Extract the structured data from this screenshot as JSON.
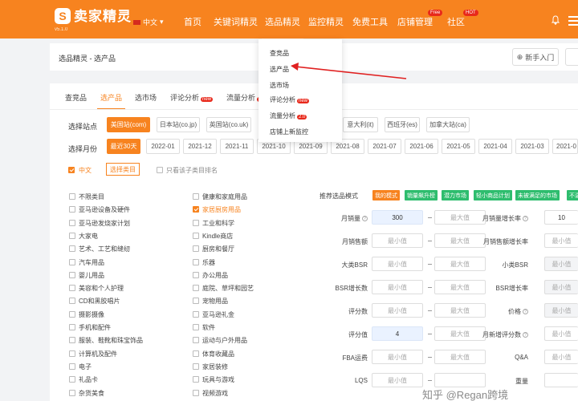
{
  "brand": {
    "logo_glyph": "S",
    "name": "卖家精灵",
    "version": "v5.1.0",
    "accent": "#f7831f"
  },
  "nav": {
    "language": "中文",
    "items": [
      {
        "label": "首页"
      },
      {
        "label": "关键词精灵"
      },
      {
        "label": "选品精灵"
      },
      {
        "label": "监控精灵"
      },
      {
        "label": "免费工具"
      },
      {
        "label": "店铺管理",
        "badge": "Free"
      },
      {
        "label": "社区",
        "badge": "HOT"
      }
    ]
  },
  "breadcrumb": "选品精灵 - 选产品",
  "help": {
    "novice": "新手入门"
  },
  "tabs": [
    {
      "label": "查竞品"
    },
    {
      "label": "选产品"
    },
    {
      "label": "选市场"
    },
    {
      "label": "评论分析",
      "tag": "new"
    },
    {
      "label": "流量分析",
      "tag": "2"
    }
  ],
  "stations": {
    "label": "选择站点",
    "options": [
      "美国站(com)",
      "日本站(co.jp)",
      "英国站(co.uk)",
      "意大利(it)",
      "西班牙(es)",
      "加拿大站(ca)"
    ]
  },
  "months": {
    "label": "选择月份",
    "options": [
      "最近30天",
      "2022-01",
      "2021-12",
      "2021-11",
      "2021-10",
      "2021-09",
      "2021-08",
      "2021-07",
      "2021-06",
      "2021-05",
      "2021-04",
      "2021-03",
      "2021-0"
    ]
  },
  "category_bar": {
    "lang": "中文",
    "select_button": "选择类目",
    "only_label": "只看该子类目排名"
  },
  "categories_left": [
    "不限类目",
    "亚马逊设备及硬件",
    "亚马逊发烧家计划",
    "大家电",
    "艺术、工艺和缝纫",
    "汽车用品",
    "婴儿用品",
    "美容和个人护理",
    "CD和黑胶唱片",
    "摄影摄像",
    "手机和配件",
    "服装、鞋靴和珠宝饰品",
    "计算机及配件",
    "电子",
    "礼品卡",
    "杂货美食"
  ],
  "categories_right": [
    "健康和家庭用品",
    "家居厨房用品",
    "工业和科学",
    "Kindle商店",
    "厨房和餐厅",
    "乐器",
    "办公用品",
    "庭院、草坪和园艺",
    "宠物用品",
    "亚马逊礼金",
    "软件",
    "运动与户外用品",
    "体育收藏品",
    "家居装修",
    "玩具与游戏",
    "视频游戏"
  ],
  "recommend": {
    "label": "推荐选品模式",
    "modes": [
      {
        "label": "我的模式",
        "color": "#f7831f"
      },
      {
        "label": "销量飙升榜",
        "color": "#2ebd6e"
      },
      {
        "label": "潜力市场",
        "color": "#2ebd6e"
      },
      {
        "label": "轻小商品计划",
        "color": "#2ebd6e"
      },
      {
        "label": "未被满足的市场",
        "color": "#2ebd6e"
      },
      {
        "label": "不温",
        "color": "#2ebd6e"
      }
    ]
  },
  "filters_left": [
    {
      "label": "月销量",
      "help": true,
      "min": "300",
      "max": "最大值"
    },
    {
      "label": "月销售额",
      "help": false,
      "min": "最小值",
      "max": "最大值"
    },
    {
      "label": "大类BSR",
      "help": false,
      "min": "最小值",
      "max": "最大值"
    },
    {
      "label": "BSR增长数",
      "help": false,
      "min": "最小值",
      "max": "最大值"
    },
    {
      "label": "评分数",
      "help": false,
      "min": "最小值",
      "max": "最大值"
    },
    {
      "label": "评分值",
      "help": false,
      "min": "4",
      "max": "最大值"
    },
    {
      "label": "FBA运费",
      "help": false,
      "min": "最小值",
      "max": "最大值"
    },
    {
      "label": "LQS",
      "help": false,
      "min": "最小值",
      "max": ""
    }
  ],
  "filters_right": [
    {
      "label": "月销量增长率",
      "help": true,
      "min": "10"
    },
    {
      "label": "月销售额增长率",
      "help": false,
      "min": "最小值"
    },
    {
      "label": "小类BSR",
      "help": false,
      "min": "最小值"
    },
    {
      "label": "BSR增长率",
      "help": false,
      "min": "最小值"
    },
    {
      "label": "价格",
      "help": true,
      "min": "最小值"
    },
    {
      "label": "月新增评分数",
      "help": true,
      "min": "最小值"
    },
    {
      "label": "Q&A",
      "help": false,
      "min": "最小值"
    },
    {
      "label": "重量",
      "help": false,
      "min": ""
    }
  ],
  "dropdown": {
    "items": [
      {
        "label": "查竞品"
      },
      {
        "label": "选产品"
      },
      {
        "label": "选市场"
      },
      {
        "label": "评论分析",
        "tag": "new",
        "tag_color": "#e8291b"
      },
      {
        "label": "流量分析",
        "tag": "2.0",
        "tag_color": "#e8291b"
      },
      {
        "label": "店铺上新监控"
      }
    ]
  },
  "watermark": "知乎 @Regan跨境"
}
